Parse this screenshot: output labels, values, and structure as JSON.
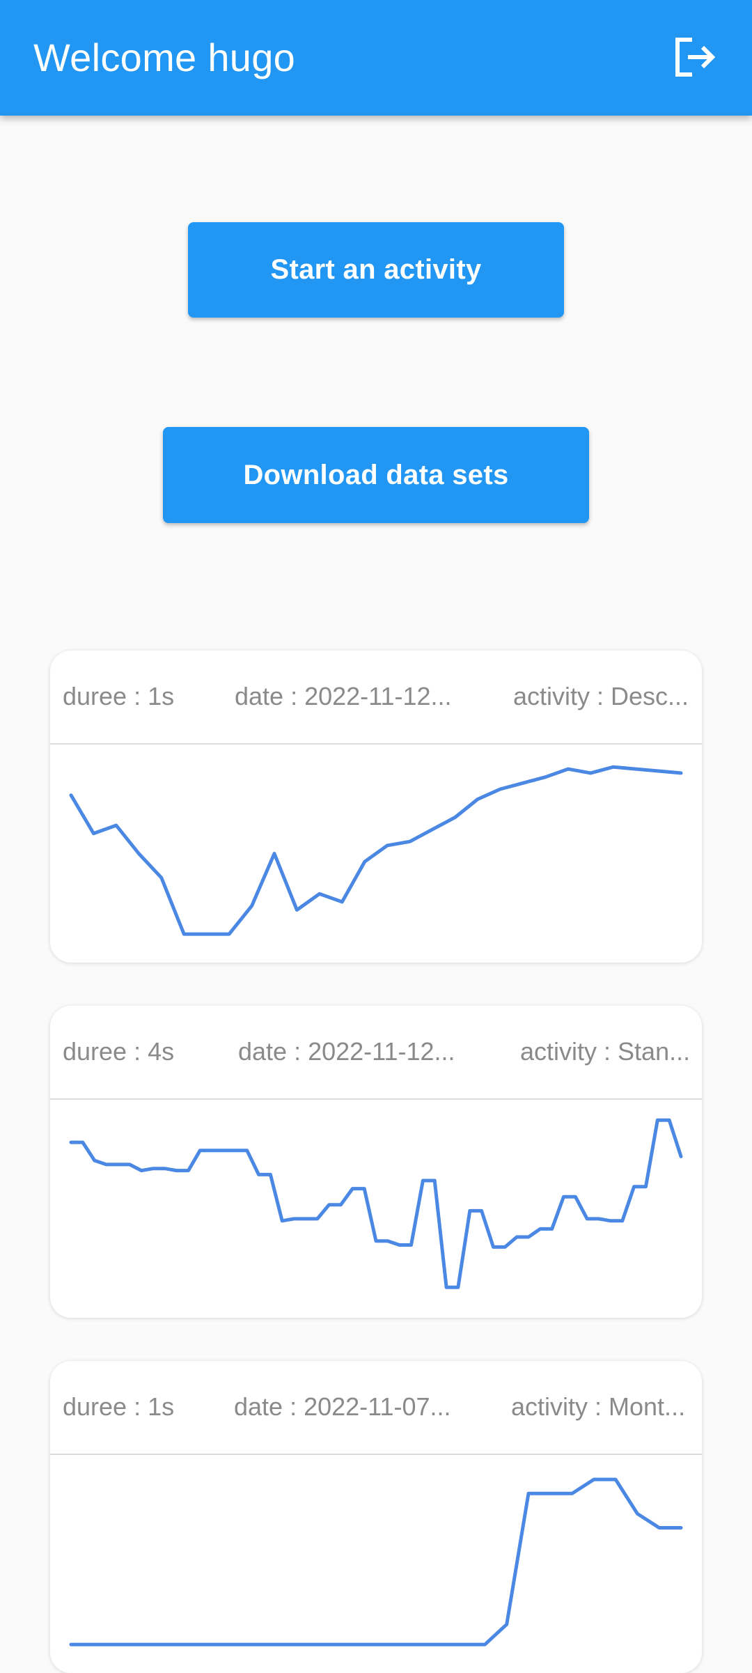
{
  "app_bar": {
    "title": "Welcome hugo",
    "background_color": "#2196f3",
    "logout_icon": "logout-icon"
  },
  "actions": {
    "start_label": "Start an activity",
    "download_label": "Download data sets"
  },
  "activities": [
    {
      "duree": "duree : 1s",
      "date": "date : 2022-11-12...",
      "activity": "activity : Desc...",
      "signal": [
        0.79,
        0.6,
        0.64,
        0.5,
        0.38,
        0.1,
        0.1,
        0.1,
        0.24,
        0.5,
        0.22,
        0.3,
        0.26,
        0.46,
        0.54,
        0.56,
        0.62,
        0.68,
        0.77,
        0.82,
        0.85,
        0.88,
        0.92,
        0.9,
        0.93,
        0.92,
        0.91,
        0.9
      ]
    },
    {
      "duree": "duree : 4s",
      "date": "date : 2022-11-12...",
      "activity": "activity : Stan...",
      "signal": [
        0.83,
        0.83,
        0.74,
        0.72,
        0.72,
        0.72,
        0.69,
        0.7,
        0.7,
        0.69,
        0.69,
        0.79,
        0.79,
        0.79,
        0.79,
        0.79,
        0.67,
        0.67,
        0.44,
        0.45,
        0.45,
        0.45,
        0.52,
        0.52,
        0.6,
        0.6,
        0.34,
        0.34,
        0.32,
        0.32,
        0.64,
        0.64,
        0.11,
        0.11,
        0.49,
        0.49,
        0.31,
        0.31,
        0.36,
        0.36,
        0.4,
        0.4,
        0.56,
        0.56,
        0.45,
        0.45,
        0.44,
        0.44,
        0.61,
        0.61,
        0.94,
        0.94,
        0.76
      ]
    },
    {
      "duree": "duree : 1s",
      "date": "date : 2022-11-07...",
      "activity": "activity : Mont...",
      "signal": [
        0.1,
        0.1,
        0.1,
        0.1,
        0.1,
        0.1,
        0.1,
        0.1,
        0.1,
        0.1,
        0.1,
        0.1,
        0.1,
        0.1,
        0.1,
        0.1,
        0.1,
        0.1,
        0.1,
        0.1,
        0.2,
        0.85,
        0.85,
        0.85,
        0.92,
        0.92,
        0.75,
        0.68,
        0.68
      ]
    }
  ]
}
